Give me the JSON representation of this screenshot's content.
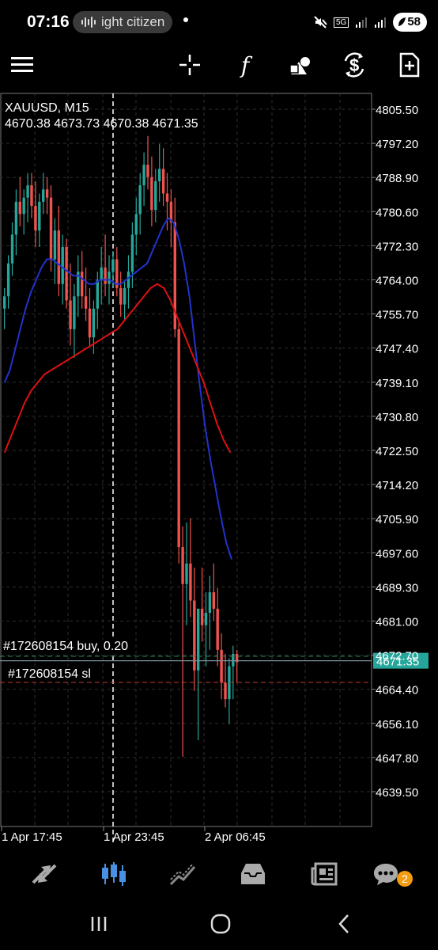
{
  "status_bar": {
    "time": "07:16",
    "pill_text": "ight citizen",
    "network": "5G",
    "battery": "58"
  },
  "toolbar": {
    "icons": [
      "menu-icon",
      "crosshair-icon",
      "indicators-icon",
      "objects-icon",
      "symbol-switch-icon",
      "new-order-icon"
    ]
  },
  "chart": {
    "symbol": "XAUUSD, M15",
    "ohlc": "4670.38 4673.73 4670.38 4671.35",
    "price_labels": [
      "4805.50",
      "4797.20",
      "4788.90",
      "4780.60",
      "4772.30",
      "4764.00",
      "4755.70",
      "4747.40",
      "4739.10",
      "4730.80",
      "4722.50",
      "4714.20",
      "4705.90",
      "4697.60",
      "4689.30",
      "4681.00",
      "4672.70",
      "4664.40",
      "4656.10",
      "4647.80",
      "4639.50"
    ],
    "current_price": "4671.35",
    "time_labels": [
      "1 Apr 17:45",
      "1 Apr 23:45",
      "2 Apr 06:45"
    ],
    "trade_label": "#172608154 buy, 0.20",
    "sl_label": "#172608154 sl",
    "colors": {
      "bull": "#26a69a",
      "bear": "#ef5350",
      "ma_fast": "#2233cc",
      "ma_slow": "#dd1111",
      "bid_line": "#78909c",
      "sl_line": "#c0392b"
    }
  },
  "bottom_nav": {
    "items": [
      "quotes-icon",
      "chart-icon",
      "trade-icon",
      "history-icon",
      "news-icon",
      "messages-icon"
    ],
    "messages_badge": "2"
  }
}
